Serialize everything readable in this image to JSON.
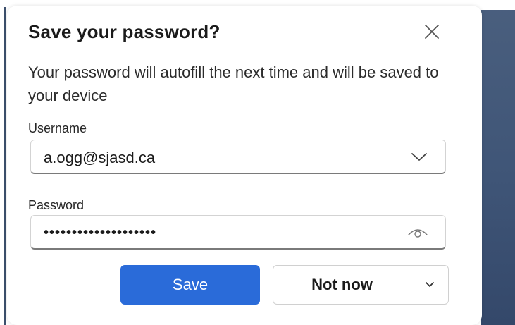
{
  "dialog": {
    "title": "Save your password?",
    "message": "Your password will autofill the next time and will be saved to your device",
    "close_icon": "close-icon"
  },
  "username": {
    "label": "Username",
    "value": "a.ogg@sjasd.ca",
    "icon": "chevron-down-icon"
  },
  "password": {
    "label": "Password",
    "masked_value": "••••••••••••••••••••",
    "icon": "eye-icon"
  },
  "actions": {
    "save_label": "Save",
    "not_now_label": "Not now",
    "more_icon": "chevron-down-icon"
  },
  "colors": {
    "accent": "#2a6bd9",
    "background_panel": "#3f5577"
  }
}
